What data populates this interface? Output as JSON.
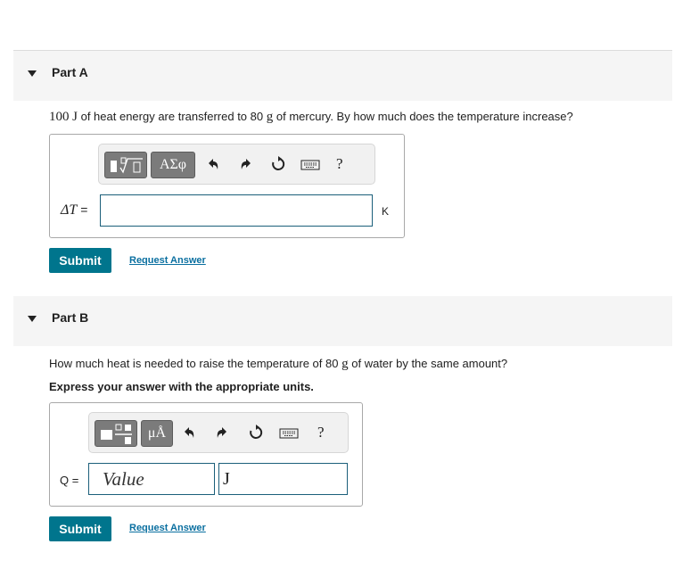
{
  "partA": {
    "title": "Part A",
    "question_value": "100",
    "question_unit": "J",
    "question_mid": "of heat energy are transferred to",
    "question_mass": "80",
    "question_mass_unit": "g",
    "question_end": "of mercury. By how much does the temperature increase?",
    "toolbar": {
      "templates_icon": "templates-icon",
      "greek_label": "ΑΣφ",
      "undo_icon": "undo-icon",
      "redo_icon": "redo-icon",
      "reset_icon": "reset-icon",
      "keyboard_icon": "keyboard-icon",
      "help_label": "?"
    },
    "answer_label_symbol": "ΔT",
    "answer_label_eq": "=",
    "answer_value": "",
    "unit": "K",
    "submit_label": "Submit",
    "request_answer_label": "Request Answer"
  },
  "partB": {
    "title": "Part B",
    "question_start": "How much heat is needed to raise the temperature of",
    "question_mass": "80",
    "question_mass_unit": "g",
    "question_end": "of water by the same amount?",
    "instruction": "Express your answer with the appropriate units.",
    "toolbar": {
      "templates_icon": "templates-icon",
      "units_label": "μÅ",
      "undo_icon": "undo-icon",
      "redo_icon": "redo-icon",
      "reset_icon": "reset-icon",
      "keyboard_icon": "keyboard-icon",
      "help_label": "?"
    },
    "answer_label": "Q =",
    "value_placeholder": "Value",
    "unit_value": "J",
    "submit_label": "Submit",
    "request_answer_label": "Request Answer"
  },
  "colors": {
    "submit": "#00758d",
    "link": "#0a6fa0",
    "input_border": "#1b5f7a",
    "header_bg": "#f5f5f5"
  }
}
